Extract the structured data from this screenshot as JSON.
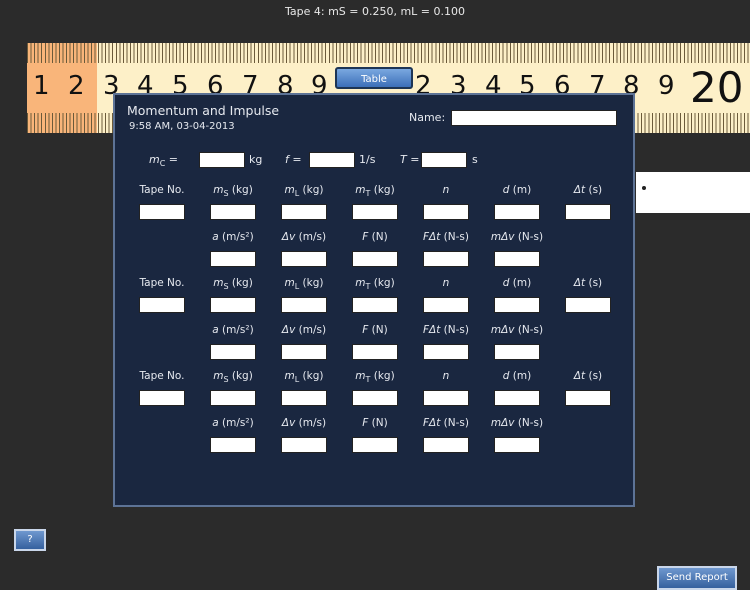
{
  "status": "Tape 4: mS = 0.250, mL = 0.100",
  "ruler": {
    "numbers": [
      "1",
      "2",
      "3",
      "4",
      "5",
      "6",
      "7",
      "8",
      "9",
      "2",
      "3",
      "4",
      "5",
      "6",
      "7",
      "8",
      "9",
      "20"
    ]
  },
  "table_button": "Table",
  "panel": {
    "title": "Momentum and Impulse",
    "timestamp": "9:58 AM, 03-04-2013",
    "name_label": "Name:",
    "name_value": "",
    "params": [
      {
        "sym": "m",
        "sub": "C",
        "eq": " =",
        "unit": "kg"
      },
      {
        "sym": "f",
        "sub": "",
        "eq": " =",
        "unit": "1/s"
      },
      {
        "sym": "T",
        "sub": "",
        "eq": " =",
        "unit": "s"
      }
    ],
    "row1_headers": [
      {
        "pre": "",
        "sym": "",
        "sub": "",
        "text": "Tape No."
      },
      {
        "sym": "m",
        "sub": "S",
        "text": " (kg)"
      },
      {
        "sym": "m",
        "sub": "L",
        "text": " (kg)"
      },
      {
        "sym": "m",
        "sub": "T",
        "text": " (kg)"
      },
      {
        "sym": "n",
        "sub": "",
        "text": ""
      },
      {
        "sym": "d",
        "sub": "",
        "text": " (m)"
      },
      {
        "sym": "Δt",
        "sub": "",
        "text": " (s)"
      }
    ],
    "row2_headers": [
      {
        "sym": "a",
        "sub": "",
        "text": " (m/s²)"
      },
      {
        "sym": "Δv",
        "sub": "",
        "text": " (m/s)"
      },
      {
        "sym": "F",
        "sub": "",
        "text": " (N)"
      },
      {
        "sym": "FΔt",
        "sub": "",
        "text": " (N-s)"
      },
      {
        "sym": "mΔv",
        "sub": "",
        "text": " (N-s)"
      }
    ],
    "groups": 3,
    "send_button": "Send Report"
  },
  "help_button": "?"
}
